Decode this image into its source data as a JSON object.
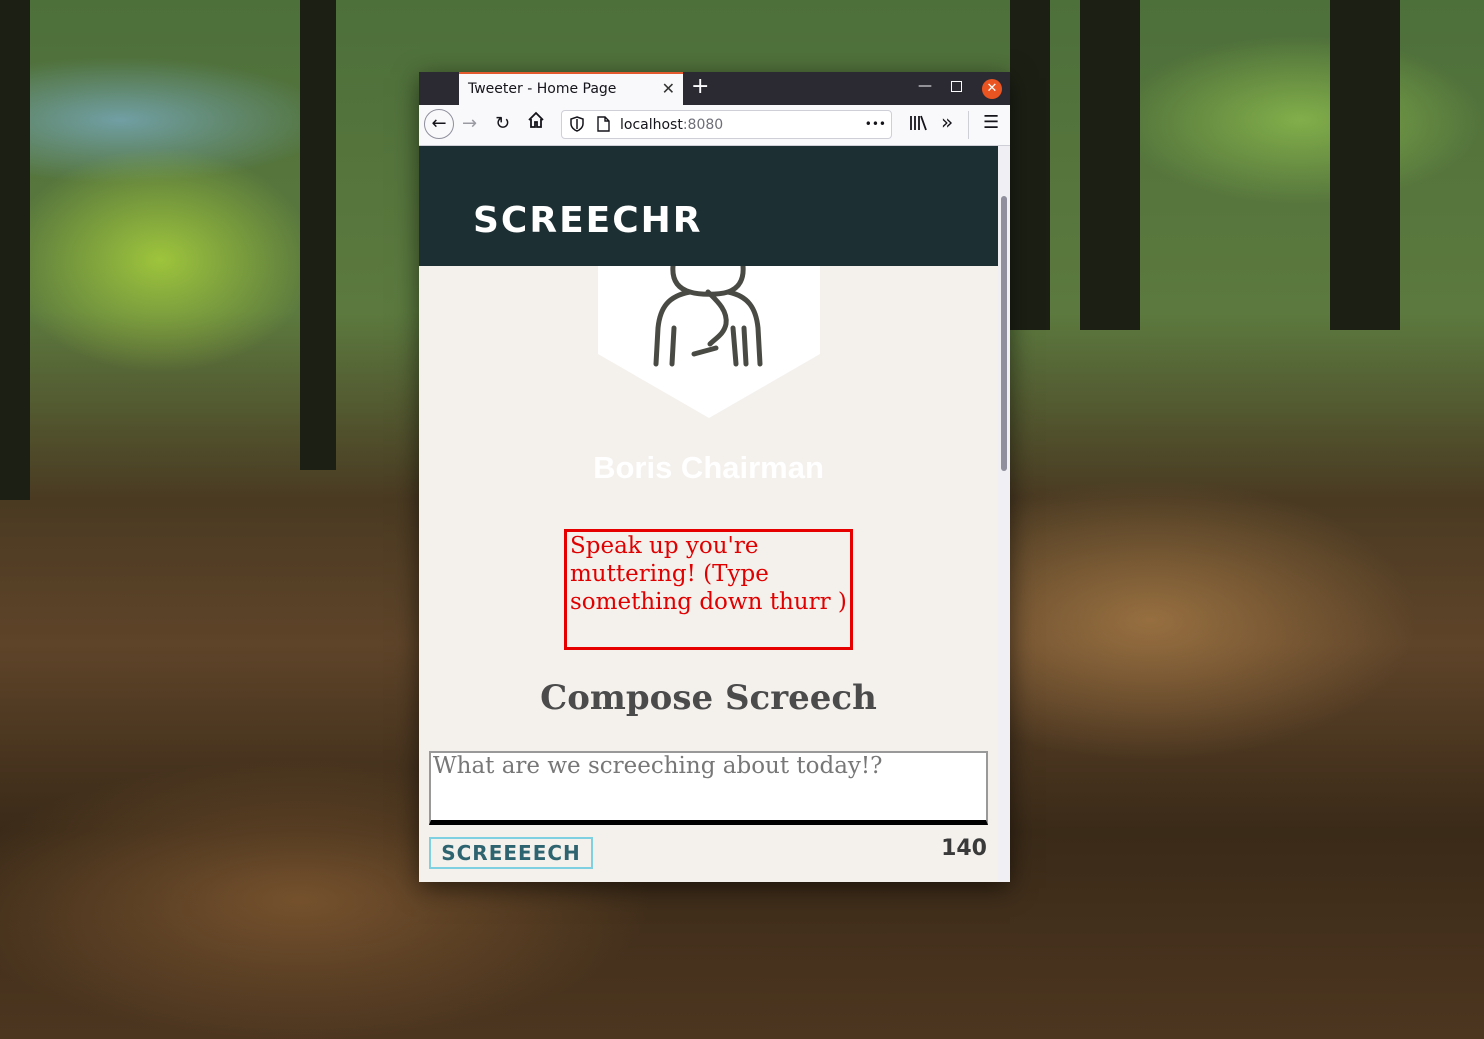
{
  "browser": {
    "tab_title": "Tweeter - Home Page",
    "tab_close": "✕",
    "new_tab": "+",
    "url_host": "localhost",
    "url_port": ":8080",
    "url_more": "•••"
  },
  "page": {
    "brand": "SCREECHR",
    "username": "Boris Chairman",
    "error_message": "Speak up you're muttering! (Type something down thurr )",
    "compose_title": "Compose Screech",
    "compose_placeholder": "What are we screeching about today!?",
    "submit_label": "SCREEEECH",
    "char_count": "140"
  },
  "colors": {
    "header_bg": "#1c2f33",
    "page_bg": "#f4f1ed",
    "error": "#e00000",
    "button_border": "#7fd0e0"
  },
  "icons": [
    "back-arrow-icon",
    "forward-arrow-icon",
    "reload-icon",
    "home-icon",
    "shield-icon",
    "page-icon",
    "library-icon",
    "overflow-chevrons-icon",
    "hamburger-menu-icon",
    "user-avatar-icon"
  ]
}
